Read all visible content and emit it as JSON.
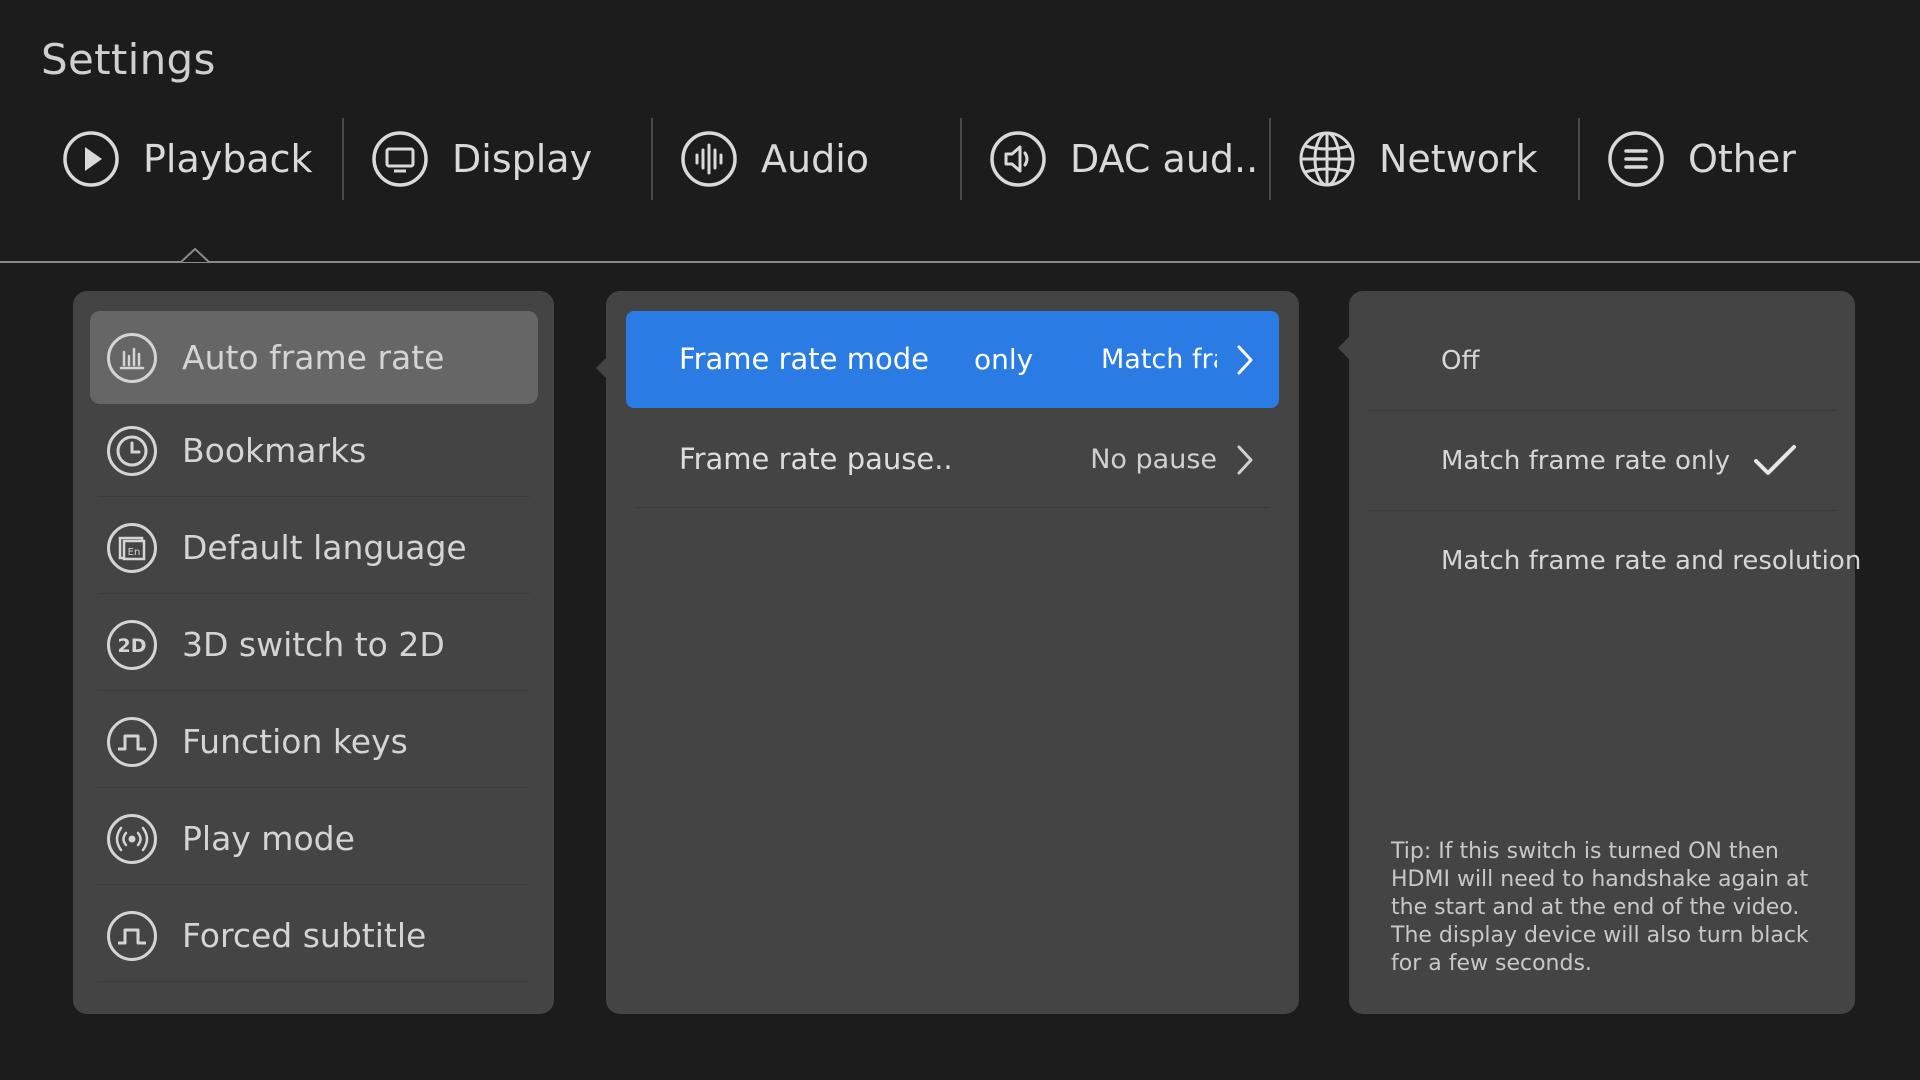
{
  "title": "Settings",
  "tabs": [
    {
      "label": "Playback",
      "icon": "play-circle-icon"
    },
    {
      "label": "Display",
      "icon": "monitor-icon"
    },
    {
      "label": "Audio",
      "icon": "audio-waveform-icon"
    },
    {
      "label": "DAC aud..",
      "icon": "speaker-icon"
    },
    {
      "label": "Network",
      "icon": "globe-icon"
    },
    {
      "label": "Other",
      "icon": "menu-lines-icon"
    }
  ],
  "playback_menu": [
    {
      "label": "Auto frame rate",
      "icon": "bar-chart-icon"
    },
    {
      "label": "Bookmarks",
      "icon": "clock-icon"
    },
    {
      "label": "Default language",
      "icon": "language-icon"
    },
    {
      "label": "3D switch to 2D",
      "icon": "2d-icon"
    },
    {
      "label": "Function keys",
      "icon": "function-key-icon"
    },
    {
      "label": "Play mode",
      "icon": "broadcast-icon"
    },
    {
      "label": "Forced subtitle",
      "icon": "subtitle-icon"
    }
  ],
  "auto_frame_rate": {
    "rows": [
      {
        "label": "Frame rate mode",
        "scroll_text": "only",
        "value": "Match fra"
      },
      {
        "label": "Frame rate pause..",
        "value": "No pause"
      }
    ]
  },
  "frame_rate_mode_options": {
    "options": [
      {
        "label": "Off",
        "checked": false
      },
      {
        "label": "Match frame rate only",
        "checked": true
      },
      {
        "label": "Match frame rate and resolution",
        "checked": false
      }
    ],
    "tip": "Tip: If this switch is turned ON then HDMI will need to handshake again at the start and at the end of the video. The display device will also turn black for a few seconds."
  },
  "colors": {
    "background": "#1c1c1c",
    "panel": "#444444",
    "selected_item": "#666666",
    "accent": "#2a7be3"
  }
}
